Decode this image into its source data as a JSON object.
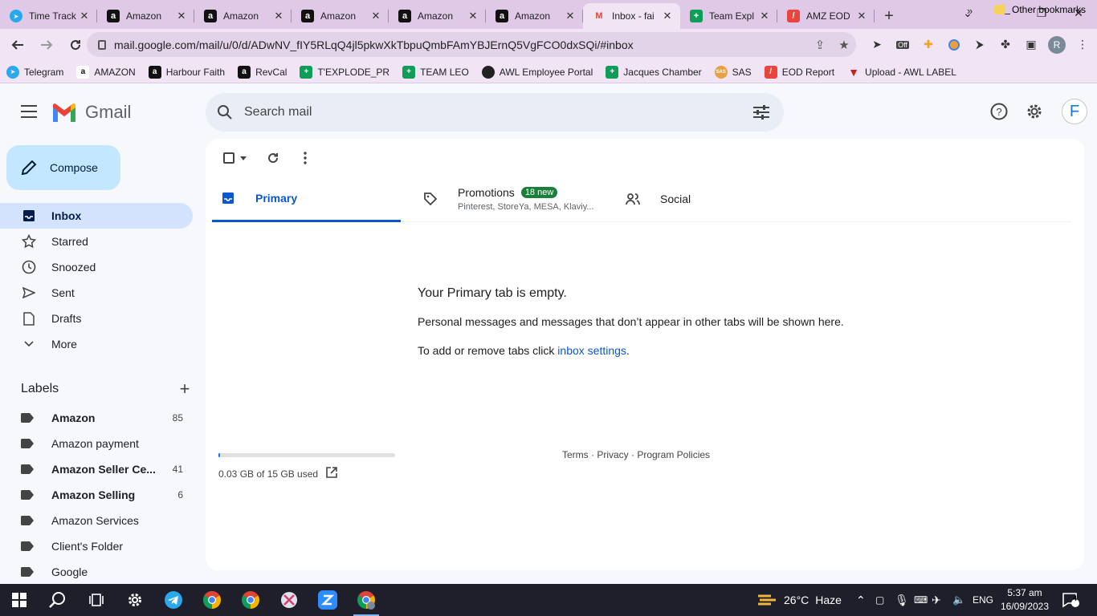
{
  "browser": {
    "tabs": [
      {
        "title": "Time Track",
        "icon": "telegram-icon",
        "color": "#29a9eb"
      },
      {
        "title": "Amazon",
        "icon": "amazon-icon",
        "color": "#111111"
      },
      {
        "title": "Amazon",
        "icon": "amazon-icon",
        "color": "#111111"
      },
      {
        "title": "Amazon",
        "icon": "amazon-icon",
        "color": "#111111"
      },
      {
        "title": "Amazon",
        "icon": "amazon-icon",
        "color": "#111111"
      },
      {
        "title": "Amazon",
        "icon": "amazon-icon",
        "color": "#111111"
      },
      {
        "title": "Inbox - fai",
        "icon": "gmail-icon",
        "color": "#ea4335",
        "active": true
      },
      {
        "title": "Team Expl",
        "icon": "sheets-icon",
        "color": "#0f9d58"
      },
      {
        "title": "AMZ EOD",
        "icon": "tool-icon",
        "color": "#e8453c"
      }
    ],
    "url": "mail.google.com/mail/u/0/d/ADwNV_fIY5RLqQ4jl5pkwXkTbpuQmbFAmYBJErnQ5VgFCO0dxSQi/#inbox",
    "extension_badge": "Off",
    "profile_initial": "R"
  },
  "bookmarks": [
    {
      "label": "Telegram",
      "icon": "telegram-icon",
      "color": "#29a9eb"
    },
    {
      "label": "AMAZON",
      "icon": "amazon-icon",
      "color": "#ffffff"
    },
    {
      "label": "Harbour Faith",
      "icon": "amazon-icon",
      "color": "#111111"
    },
    {
      "label": "RevCal",
      "icon": "amazon-icon",
      "color": "#111111"
    },
    {
      "label": "T'EXPLODE_PR",
      "icon": "sheets-icon",
      "color": "#0f9d58"
    },
    {
      "label": "TEAM LEO",
      "icon": "sheets-icon",
      "color": "#0f9d58"
    },
    {
      "label": "AWL Employee Portal",
      "icon": "globe-icon",
      "color": "#222222"
    },
    {
      "label": "Jacques Chamber",
      "icon": "sheets-icon",
      "color": "#0f9d58"
    },
    {
      "label": "SAS",
      "icon": "sas-icon",
      "color": "#e8a040"
    },
    {
      "label": "EOD Report",
      "icon": "tool-icon",
      "color": "#e8453c"
    },
    {
      "label": "Upload - AWL LABEL",
      "icon": "label-icon",
      "color": "#c5221f"
    }
  ],
  "bookmarks_more": "»",
  "other_bookmarks": "Other bookmarks",
  "gmail": {
    "product_name": "Gmail",
    "search_placeholder": "Search mail",
    "account_initial": "F",
    "compose_label": "Compose",
    "nav": [
      {
        "label": "Inbox",
        "icon": "inbox-icon",
        "active": true
      },
      {
        "label": "Starred",
        "icon": "star-icon"
      },
      {
        "label": "Snoozed",
        "icon": "clock-icon"
      },
      {
        "label": "Sent",
        "icon": "send-icon"
      },
      {
        "label": "Drafts",
        "icon": "draft-icon"
      },
      {
        "label": "More",
        "icon": "chevron-down-icon"
      }
    ],
    "labels_heading": "Labels",
    "labels": [
      {
        "name": "Amazon",
        "count": "85",
        "bold": true
      },
      {
        "name": "Amazon payment",
        "count": "",
        "bold": false
      },
      {
        "name": "Amazon Seller Ce...",
        "count": "41",
        "bold": true
      },
      {
        "name": "Amazon Selling",
        "count": "6",
        "bold": true
      },
      {
        "name": "Amazon Services",
        "count": "",
        "bold": false
      },
      {
        "name": "Client's Folder",
        "count": "",
        "bold": false
      },
      {
        "name": "Google",
        "count": "",
        "bold": false
      }
    ],
    "tabs": {
      "primary": "Primary",
      "promotions": "Promotions",
      "promotions_badge": "18 new",
      "promotions_senders": "Pinterest, StoreYa, MESA, Klaviy...",
      "social": "Social"
    },
    "empty": {
      "heading": "Your Primary tab is empty.",
      "body": "Personal messages and messages that don’t appear in other tabs will be shown here.",
      "settings_prefix": "To add or remove tabs click ",
      "settings_link": "inbox settings",
      "settings_suffix": "."
    },
    "storage": {
      "text": "0.03 GB of 15 GB used",
      "used_fraction": 0.002
    },
    "footer": "Terms · Privacy · Program Policies"
  },
  "taskbar": {
    "weather_temp": "26°C",
    "weather_desc": "Haze",
    "language": "ENG",
    "time": "5:37 am",
    "date": "16/09/2023",
    "notifications": "4"
  }
}
